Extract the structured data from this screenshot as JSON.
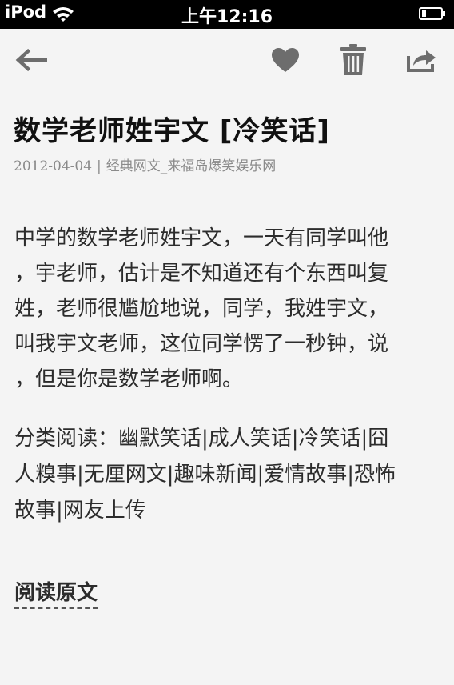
{
  "status_bar": {
    "carrier": "iPod",
    "time": "上午12:16"
  },
  "toolbar": {
    "back_icon": "back-arrow-icon",
    "favorite_icon": "heart-icon",
    "delete_icon": "trash-icon",
    "share_icon": "share-icon",
    "icon_color": "#6d6d6d"
  },
  "article": {
    "title": "数学老师姓宇文 [冷笑话]",
    "date": "2012-04-04",
    "separator": "|",
    "source": "经典网文_来福岛爆笑娱乐网",
    "body_lines": [
      "中学的数学老师姓宇文，一天有同学叫他",
      "，宇老师，估计是不知道还有个东西叫复",
      "姓，老师很尴尬地说，同学，我姓宇文，",
      "叫我宇文老师，这位同学愣了一秒钟，说",
      "，但是你是数学老师啊。"
    ],
    "category_lines": [
      "分类阅读：幽默笑话|成人笑话|冷笑话|囧",
      "人糗事|无厘网文|趣味新闻|爱情故事|恐怖",
      "故事|网友上传"
    ],
    "read_original": "阅读原文"
  }
}
